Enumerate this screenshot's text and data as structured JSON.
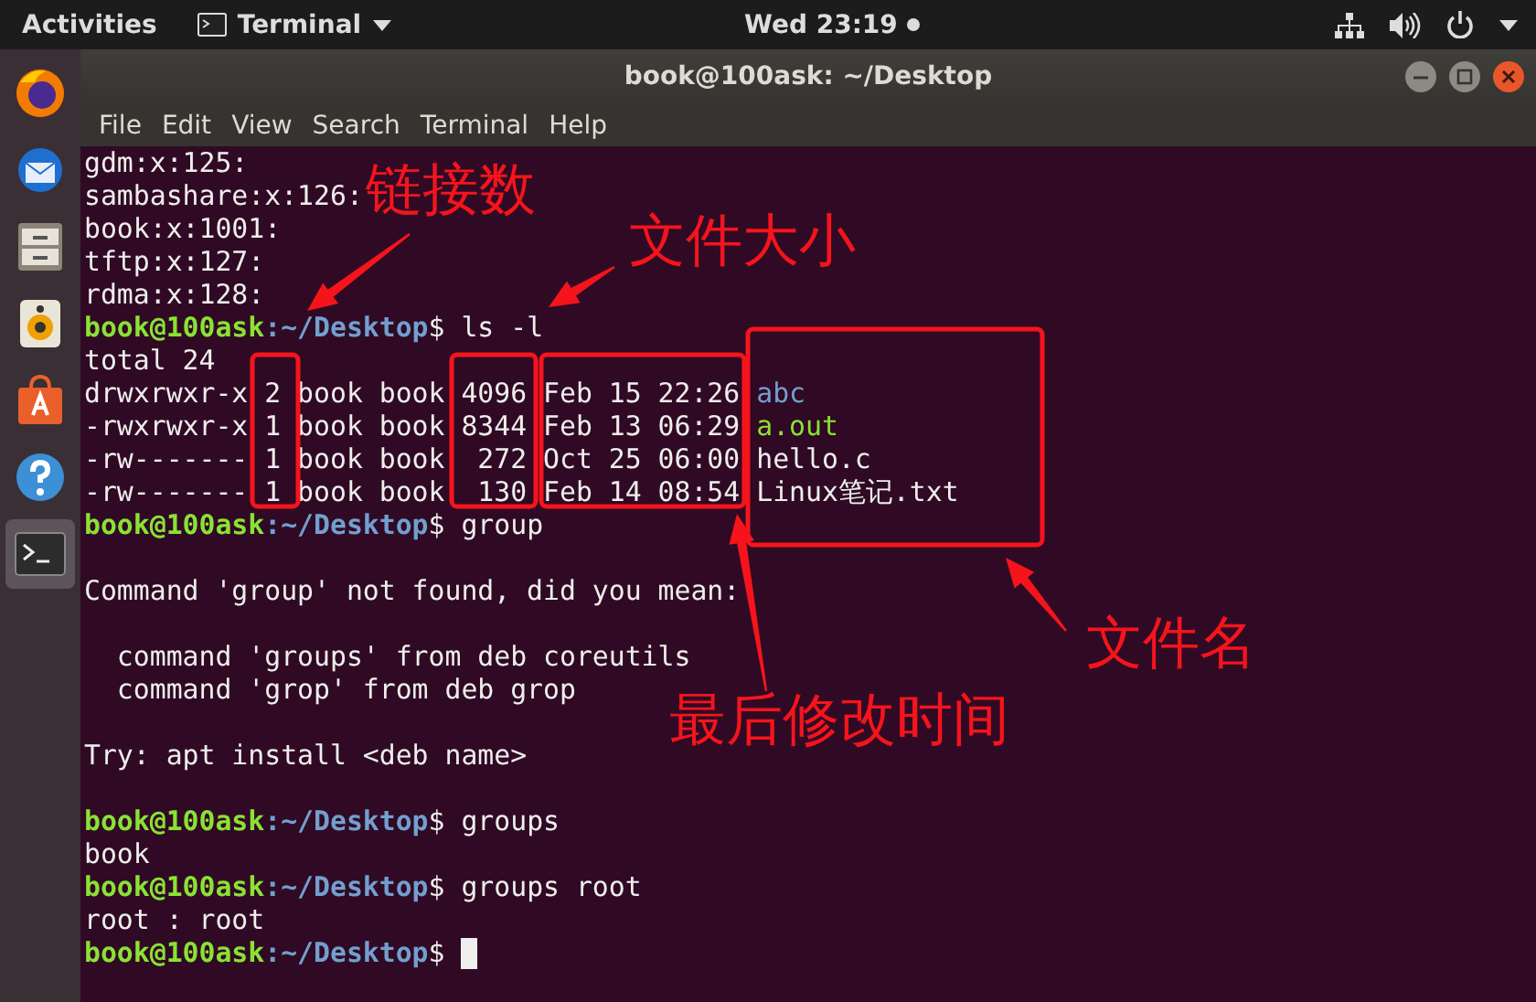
{
  "top_bar": {
    "activities": "Activities",
    "app_name": "Terminal",
    "clock": "Wed 23:19"
  },
  "dock": {
    "items": [
      {
        "kind": "firefox",
        "selected": false
      },
      {
        "kind": "mail",
        "selected": false
      },
      {
        "kind": "files",
        "selected": false
      },
      {
        "kind": "music",
        "selected": false
      },
      {
        "kind": "software",
        "selected": false
      },
      {
        "kind": "help",
        "selected": false
      },
      {
        "kind": "terminal",
        "selected": true
      }
    ]
  },
  "window": {
    "title": "book@100ask: ~/Desktop"
  },
  "menu": [
    "File",
    "Edit",
    "View",
    "Search",
    "Terminal",
    "Help"
  ],
  "terminal": {
    "lines": [
      {
        "kind": "output",
        "text": "gdm:x:125:"
      },
      {
        "kind": "output",
        "text": "sambashare:x:126:"
      },
      {
        "kind": "output",
        "text": "book:x:1001:"
      },
      {
        "kind": "output",
        "text": "tftp:x:127:"
      },
      {
        "kind": "output",
        "text": "rdma:x:128:"
      },
      {
        "kind": "prompt",
        "user": "book@100ask",
        "path": ":~/Desktop",
        "command": "$ ls -l"
      },
      {
        "kind": "output",
        "text": "total 24"
      },
      {
        "kind": "ls_row",
        "text": "drwxrwxr-x 2 book book 4096 Feb 15 22:26",
        "name": "abc",
        "color": "#729fcf"
      },
      {
        "kind": "ls_row",
        "text": "-rwxrwxr-x 1 book book 8344 Feb 13 06:29",
        "name": "a.out",
        "color": "#8ae234"
      },
      {
        "kind": "ls_row",
        "text": "-rw------- 1 book book  272 Oct 25 06:00",
        "name": "hello.c",
        "color": "#eeeeec"
      },
      {
        "kind": "ls_row",
        "text": "-rw------- 1 book book  130 Feb 14 08:54",
        "name": "Linux笔记.txt",
        "color": "#eeeeec"
      },
      {
        "kind": "prompt",
        "user": "book@100ask",
        "path": ":~/Desktop",
        "command": "$ group"
      },
      {
        "kind": "blank"
      },
      {
        "kind": "output",
        "text": "Command 'group' not found, did you mean:"
      },
      {
        "kind": "blank"
      },
      {
        "kind": "output",
        "text": "  command 'groups' from deb coreutils"
      },
      {
        "kind": "output",
        "text": "  command 'grop' from deb grop"
      },
      {
        "kind": "blank"
      },
      {
        "kind": "output",
        "text": "Try: apt install <deb name>"
      },
      {
        "kind": "blank"
      },
      {
        "kind": "prompt",
        "user": "book@100ask",
        "path": ":~/Desktop",
        "command": "$ groups"
      },
      {
        "kind": "output",
        "text": "book"
      },
      {
        "kind": "prompt",
        "user": "book@100ask",
        "path": ":~/Desktop",
        "command": "$ groups root"
      },
      {
        "kind": "output",
        "text": "root : root"
      },
      {
        "kind": "prompt",
        "user": "book@100ask",
        "path": ":~/Desktop",
        "command": "$",
        "cursor": true
      }
    ]
  },
  "annotations": [
    {
      "label": "链接数"
    },
    {
      "label": "文件大小"
    },
    {
      "label": "最后修改时间"
    },
    {
      "label": "文件名"
    }
  ]
}
